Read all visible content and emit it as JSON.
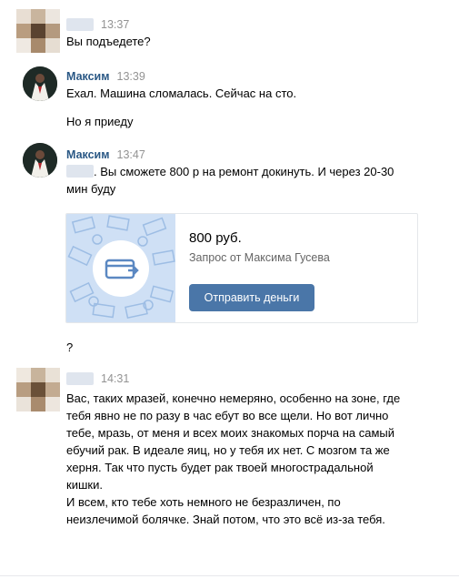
{
  "messages": [
    {
      "time": "13:37",
      "lines": [
        "Вы подъедете?"
      ]
    },
    {
      "author": "Максим",
      "time": "13:39",
      "lines": [
        "Ехал. Машина сломалась. Сейчас на сто.",
        "Но я приеду"
      ]
    },
    {
      "author": "Максим",
      "time": "13:47",
      "text_line1": ". Вы сможете 800 р на ремонт докинуть. И через 20-30",
      "text_line2": "мин буду",
      "money_request": {
        "amount": "800 руб.",
        "subtitle": "Запрос от Максима Гусева",
        "button_label": "Отправить деньги",
        "accent_color": "#4a76a8"
      }
    },
    {
      "text": "?"
    },
    {
      "time": "14:31",
      "paragraph": [
        "Вас, таких мразей, конечно немеряно, особенно на зоне, где",
        "тебя явно не по разу в час ебут во все щели. Но вот лично",
        "тебе, мразь, от меня и всех моих знакомых порча на самый",
        "ебучий рак. В идеале яиц, но у тебя их нет. С мозгом та же",
        "херня. Так что пусть будет рак твоей многострадальной",
        "кишки.",
        "И всем, кто тебе хоть немного не безразличен, по",
        "неизлечимой болячке. Знай потом, что это всё из-за тебя."
      ]
    }
  ]
}
